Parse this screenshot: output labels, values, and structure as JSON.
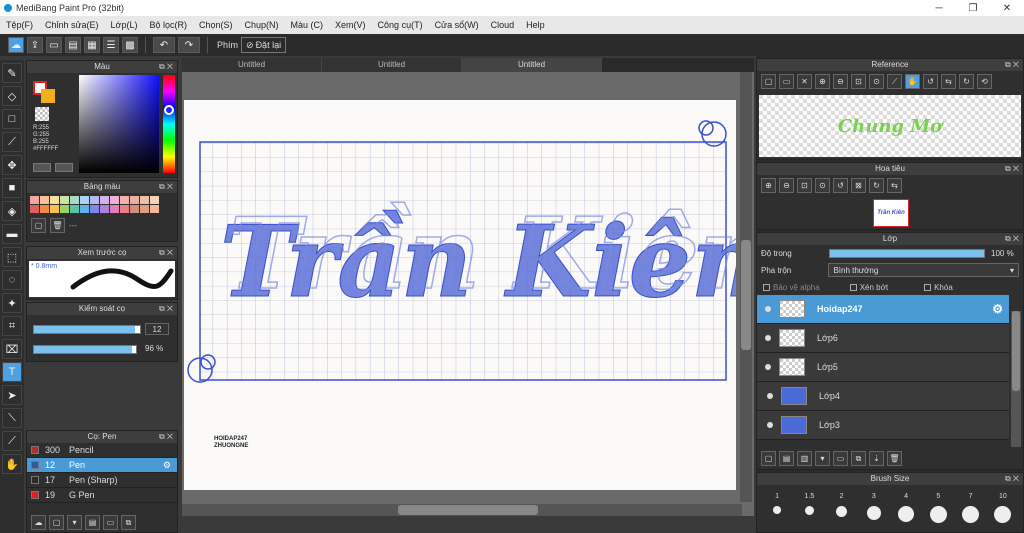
{
  "window": {
    "title": "MediBang Paint Pro (32bit)"
  },
  "menu": [
    "Tệp(F)",
    "Chỉnh sửa(E)",
    "Lớp(L)",
    "Bộ lọc(R)",
    "Chọn(S)",
    "Chụp(N)",
    "Màu (C)",
    "Xem(V)",
    "Công cụ(T)",
    "Cửa sổ(W)",
    "Cloud",
    "Help"
  ],
  "toolbar": {
    "phim_label": "Phím",
    "reset_label": "Đặt lại"
  },
  "doc_tabs": [
    "Untitled",
    "Untitled",
    "Untitled"
  ],
  "color_panel": {
    "title": "Màu",
    "r": "R:255",
    "g": "G:255",
    "b": "B:255",
    "hex": "#FFFFFF"
  },
  "palette_panel": {
    "title": "Bảng màu",
    "colors": [
      "#f4a6a0",
      "#f7c29a",
      "#f9e09a",
      "#c9e5a0",
      "#a9dcc6",
      "#a9d4ef",
      "#b5b9ef",
      "#d4b2ec",
      "#efb0d6",
      "#f2b0b0",
      "#eab0a0",
      "#f0c0a8",
      "#f5d2bc",
      "#e06060",
      "#f08a4b",
      "#f7c14b",
      "#9bd36a",
      "#5fc3a6",
      "#5fb2e8",
      "#7f88e8",
      "#b07fe0",
      "#e07fc0",
      "#e88080",
      "#d09080",
      "#e0a080",
      "#f2b79a"
    ],
    "dash": "---"
  },
  "brush_preview": {
    "title": "Xem trước cọ",
    "size": "0.8mm"
  },
  "brush_control": {
    "title": "Kiểm soát cọ",
    "size_value": "12",
    "opacity_value": "96",
    "opacity_unit": "%",
    "size_fill": 0.95,
    "opacity_fill": 0.96
  },
  "brush_list": {
    "title": "Cọ: Pen",
    "items": [
      {
        "num": "300",
        "name": "Pencil",
        "color": "#b03030"
      },
      {
        "num": "12",
        "name": "Pen",
        "color": "#2a5ca0"
      },
      {
        "num": "17",
        "name": "Pen (Sharp)",
        "color": "#2a2a2a"
      },
      {
        "num": "19",
        "name": "G Pen",
        "color": "#e02020"
      }
    ]
  },
  "canvas": {
    "text": "Trần Kiên",
    "watermark_line1": "HOIDAP247",
    "watermark_line2": "ZHUONGNE",
    "accent": "#3a50d0"
  },
  "reference_panel": {
    "title": "Reference",
    "preview_text": "Chung Mơ"
  },
  "navigator_panel": {
    "title": "Hoa tiêu",
    "preview_text": "Trần Kiên"
  },
  "layer_panel": {
    "title": "Lớp",
    "opacity_label": "Độ trong",
    "opacity_value": "100",
    "opacity_unit": "%",
    "opacity_fill": 1.0,
    "blend_label": "Pha trộn",
    "blend_value": "Bình thường",
    "protect_alpha": "Bảo vệ alpha",
    "clipping": "Xén bớt",
    "lock": "Khóa",
    "layers": [
      {
        "name": "Hoidap247",
        "selected": true
      },
      {
        "name": "Lớp6",
        "selected": false
      },
      {
        "name": "Lớp5",
        "selected": false
      },
      {
        "name": "Lớp4",
        "selected": false
      },
      {
        "name": "Lớp3",
        "selected": false
      }
    ]
  },
  "brush_size_panel": {
    "title": "Brush Size",
    "sizes": [
      "1",
      "1.5",
      "2",
      "3",
      "4",
      "5",
      "7",
      "10"
    ]
  }
}
